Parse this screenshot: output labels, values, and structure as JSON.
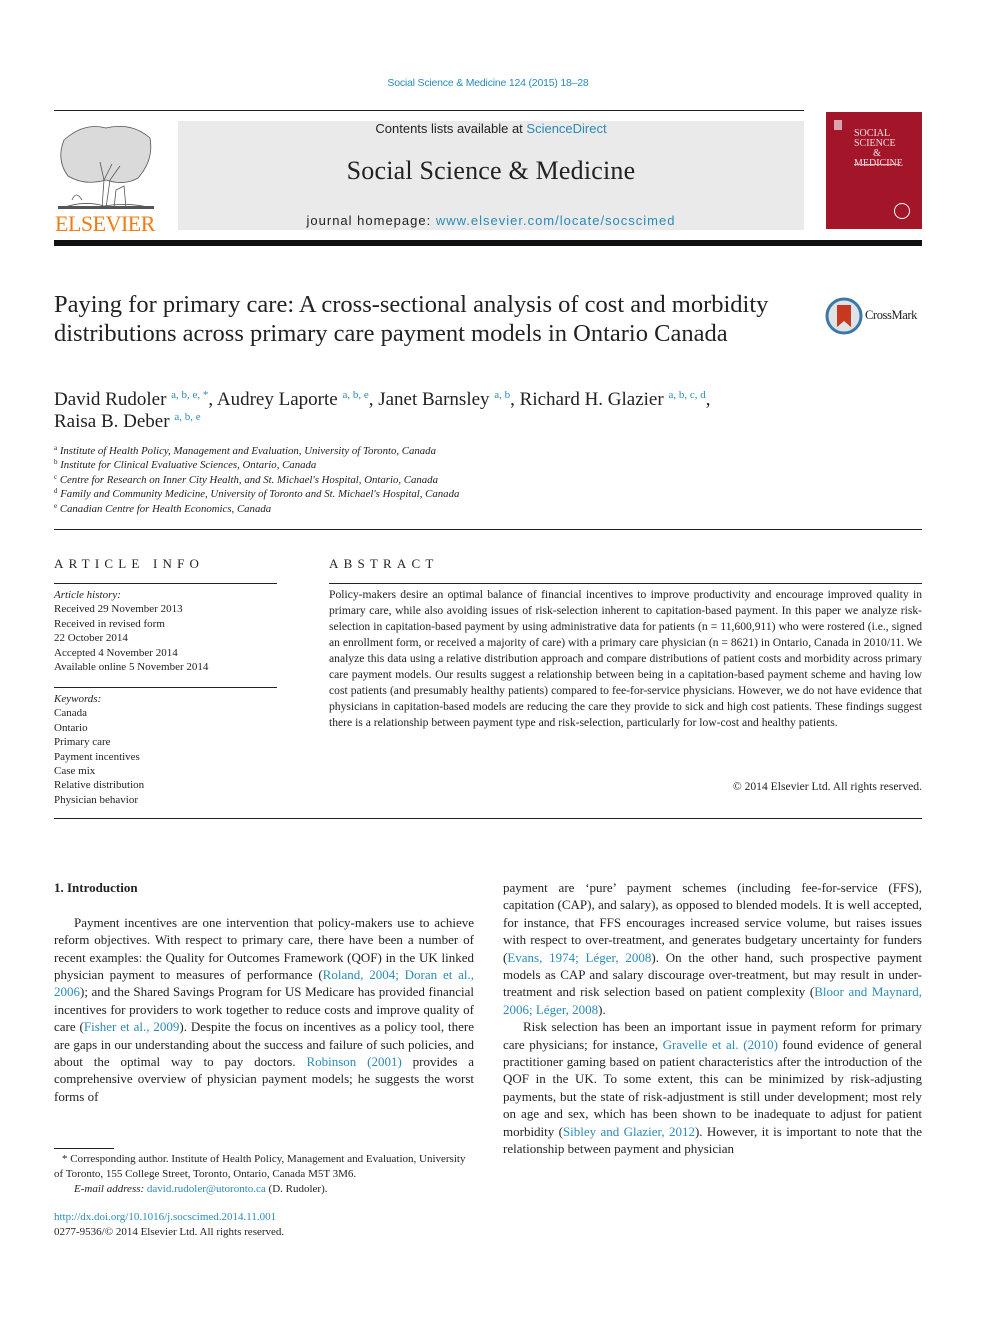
{
  "header": {
    "citation": "Social Science & Medicine 124 (2015) 18–28",
    "contents_prefix": "Contents lists available at ",
    "contents_link": "ScienceDirect",
    "journal_title": "Social Science & Medicine",
    "homepage_prefix": "journal homepage: ",
    "homepage_link": "www.elsevier.com/locate/socscimed",
    "publisher_logo_text": "ELSEVIER",
    "cover": {
      "line1": "SOCIAL",
      "line2": "SCIENCE",
      "line3": "&",
      "line4": "MEDICINE"
    },
    "brand_color": "#f07c14",
    "cover_color": "#a3162a",
    "link_color": "#2a8ab8"
  },
  "article": {
    "title": "Paying for primary care: A cross-sectional analysis of cost and morbidity distributions across primary care payment models in Ontario Canada",
    "crossmark_label": "CrossMark",
    "authors": [
      {
        "name": "David Rudoler",
        "affil": "a, b, e, *",
        "sep": ", "
      },
      {
        "name": "Audrey Laporte",
        "affil": "a, b, e",
        "sep": ", "
      },
      {
        "name": "Janet Barnsley",
        "affil": "a, b",
        "sep": ", "
      },
      {
        "name": "Richard H. Glazier",
        "affil": "a, b, c, d",
        "sep": ","
      },
      {
        "name": "Raisa B. Deber",
        "affil": "a, b, e",
        "sep": ""
      }
    ],
    "affiliations": [
      {
        "key": "a",
        "text": "Institute of Health Policy, Management and Evaluation, University of Toronto, Canada"
      },
      {
        "key": "b",
        "text": "Institute for Clinical Evaluative Sciences, Ontario, Canada"
      },
      {
        "key": "c",
        "text": "Centre for Research on Inner City Health, and St. Michael's Hospital, Ontario, Canada"
      },
      {
        "key": "d",
        "text": "Family and Community Medicine, University of Toronto and St. Michael's Hospital, Canada"
      },
      {
        "key": "e",
        "text": "Canadian Centre for Health Economics, Canada"
      }
    ]
  },
  "article_info": {
    "heading": "ARTICLE INFO",
    "history_label": "Article history:",
    "history": [
      "Received 29 November 2013",
      "Received in revised form",
      "22 October 2014",
      "Accepted 4 November 2014",
      "Available online 5 November 2014"
    ],
    "keywords_label": "Keywords:",
    "keywords": [
      "Canada",
      "Ontario",
      "Primary care",
      "Payment incentives",
      "Case mix",
      "Relative distribution",
      "Physician behavior"
    ]
  },
  "abstract": {
    "heading": "ABSTRACT",
    "body": "Policy-makers desire an optimal balance of financial incentives to improve productivity and encourage improved quality in primary care, while also avoiding issues of risk-selection inherent to capitation-based payment. In this paper we analyze risk-selection in capitation-based payment by using administrative data for patients (n = 11,600,911) who were rostered (i.e., signed an enrollment form, or received a majority of care) with a primary care physician (n = 8621) in Ontario, Canada in 2010/11. We analyze this data using a relative distribution approach and compare distributions of patient costs and morbidity across primary care payment models. Our results suggest a relationship between being in a capitation-based payment scheme and having low cost patients (and presumably healthy patients) compared to fee-for-service physicians. However, we do not have evidence that physicians in capitation-based models are reducing the care they provide to sick and high cost patients. These findings suggest there is a relationship between payment type and risk-selection, particularly for low-cost and healthy patients.",
    "copyright": "© 2014 Elsevier Ltd. All rights reserved."
  },
  "body": {
    "section_heading": "1.  Introduction",
    "left_para": [
      {
        "t": "Payment incentives are one intervention that policy-makers use to achieve reform objectives. With respect to primary care, there have been a number of recent examples: the Quality for Outcomes Framework (QOF) in the UK linked physician payment to measures of performance ("
      },
      {
        "link": "Roland, 2004; Doran et al., 2006"
      },
      {
        "t": "); and the Shared Savings Program for US Medicare has provided financial incentives for providers to work together to reduce costs and improve quality of care ("
      },
      {
        "link": "Fisher et al., 2009"
      },
      {
        "t": "). Despite the focus on incentives as a policy tool, there are gaps in our understanding about the success and failure of such policies, and about the optimal way to pay doctors. "
      },
      {
        "link": "Robinson (2001)"
      },
      {
        "t": " provides a comprehensive overview of physician payment models; he suggests the worst forms of"
      }
    ],
    "right_para1": [
      {
        "t": "payment are ‘pure’ payment schemes (including fee-for-service (FFS), capitation (CAP), and salary), as opposed to blended models. It is well accepted, for instance, that FFS encourages increased service volume, but raises issues with respect to over-treatment, and generates budgetary uncertainty for funders ("
      },
      {
        "link": "Evans, 1974; Léger, 2008"
      },
      {
        "t": "). On the other hand, such prospective payment models as CAP and salary discourage over-treatment, but may result in under-treatment and risk selection based on patient complexity ("
      },
      {
        "link": "Bloor and Maynard, 2006; Léger, 2008"
      },
      {
        "t": ")."
      }
    ],
    "right_para2": [
      {
        "t": "Risk selection has been an important issue in payment reform for primary care physicians; for instance, "
      },
      {
        "link": "Gravelle et al. (2010)"
      },
      {
        "t": " found evidence of general practitioner gaming based on patient characteristics after the introduction of the QOF in the UK. To some extent, this can be minimized by risk-adjusting payments, but the state of risk-adjustment is still under development; most rely on age and sex, which has been shown to be inadequate to adjust for patient morbidity ("
      },
      {
        "link": "Sibley and Glazier, 2012"
      },
      {
        "t": "). However, it is important to note that the relationship between payment and physician"
      }
    ]
  },
  "footnotes": {
    "corresponding": "* Corresponding author. Institute of Health Policy, Management and Evaluation, University of Toronto, 155 College Street, Toronto, Ontario, Canada M5T 3M6.",
    "email_label": "E-mail address: ",
    "email": "david.rudoler@utoronto.ca",
    "email_suffix": " (D. Rudoler).",
    "doi": "http://dx.doi.org/10.1016/j.socscimed.2014.11.001",
    "issn": "0277-9536/© 2014 Elsevier Ltd. All rights reserved."
  }
}
